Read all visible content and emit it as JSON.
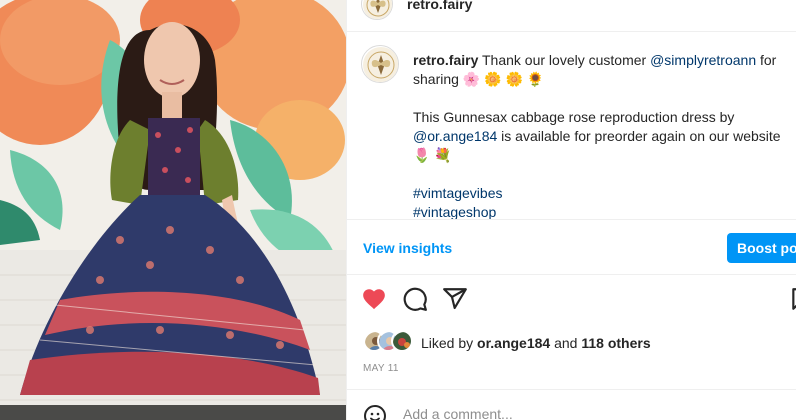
{
  "post": {
    "username": "retro.fairy",
    "caption": {
      "username": "retro.fairy",
      "line1_text": "Thank our lovely customer",
      "line1_mention": "@simplyretroann",
      "line1_suffix": "for sharing",
      "line1_emojis": "🌸 🌼 🌼 🌻",
      "line2_text": "This Gunnesax cabbage rose reproduction dress by",
      "line2_mention": "@or.ange184",
      "line2_suffix": "is available for preorder again on our website",
      "line2_emojis": "🌷 💐",
      "hashtags": [
        "#vimtagevibes",
        "#vintageshop"
      ]
    },
    "view_insights_label": "View insights",
    "boost_label": "Boost post",
    "likes": {
      "prefix": "Liked by",
      "first_liker": "or.ange184",
      "conjunction": "and",
      "others": "118 others"
    },
    "date": "MAY 11",
    "comment_placeholder": "Add a comment..."
  },
  "icons": {
    "like": "heart-filled-icon",
    "comment": "comment-bubble-icon",
    "share": "paper-plane-icon",
    "save": "bookmark-icon",
    "emoji": "smiley-icon"
  },
  "colors": {
    "like_red": "#ed4956",
    "link_blue": "#00376b",
    "accent_blue": "#0095f6",
    "muted": "#8e8e8e"
  }
}
